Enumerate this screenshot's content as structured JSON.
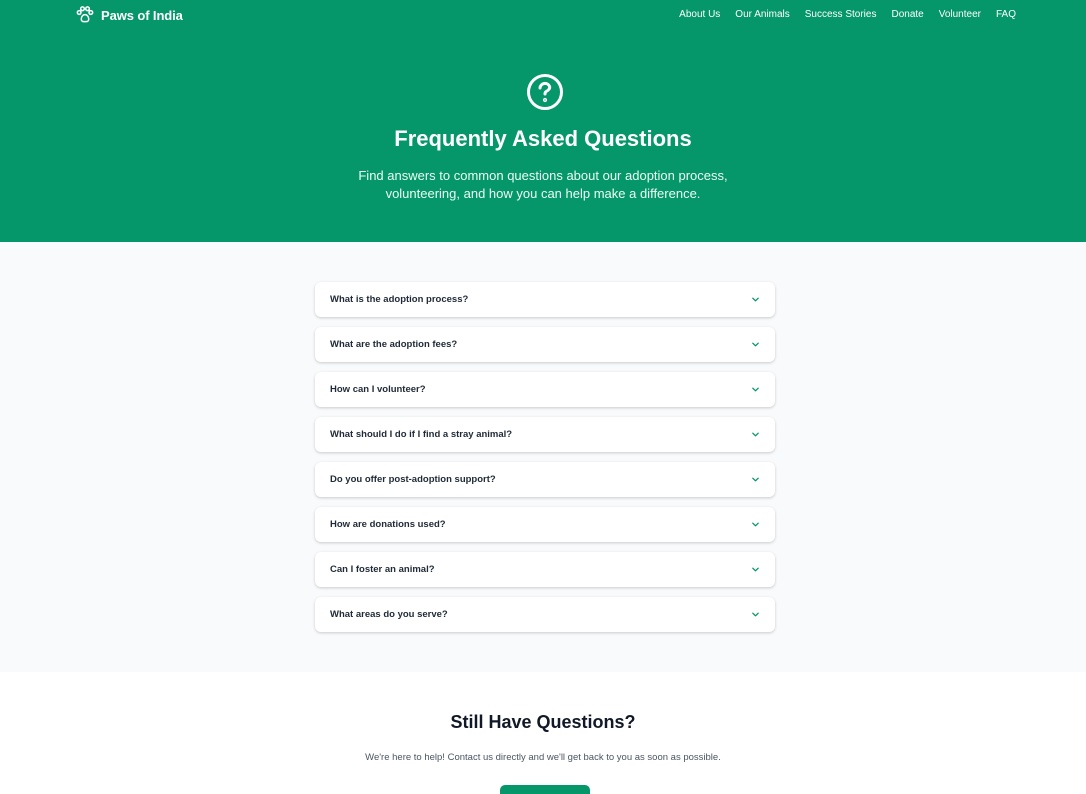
{
  "brand": {
    "name": "Paws of India",
    "icon": "paw-icon"
  },
  "nav": {
    "links": [
      "About Us",
      "Our Animals",
      "Success Stories",
      "Donate",
      "Volunteer",
      "FAQ"
    ]
  },
  "hero": {
    "icon": "question-circle-icon",
    "title": "Frequently Asked Questions",
    "subtitle": "Find answers to common questions about our adoption process, volunteering, and how you can help make a difference."
  },
  "faq": {
    "chevron_icon": "chevron-down-icon",
    "items": [
      {
        "question": "What is the adoption process?"
      },
      {
        "question": "What are the adoption fees?"
      },
      {
        "question": "How can I volunteer?"
      },
      {
        "question": "What should I do if I find a stray animal?"
      },
      {
        "question": "Do you offer post-adoption support?"
      },
      {
        "question": "How are donations used?"
      },
      {
        "question": "Can I foster an animal?"
      },
      {
        "question": "What areas do you serve?"
      }
    ]
  },
  "contact": {
    "title": "Still Have Questions?",
    "subtitle": "We're here to help! Contact us directly and we'll get back to you as soon as possible.",
    "button_label": ""
  },
  "colors": {
    "primary": "#059669",
    "section_bg": "#f8fafc",
    "text_dark": "#1f2937"
  }
}
